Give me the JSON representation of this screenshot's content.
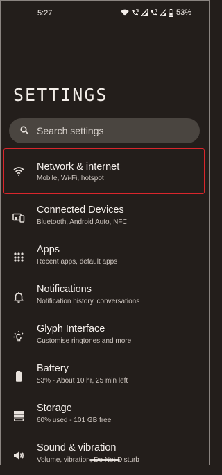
{
  "status": {
    "time": "5:27",
    "battery": "53%"
  },
  "page": {
    "title": "SETTINGS"
  },
  "search": {
    "placeholder": "Search settings"
  },
  "items": [
    {
      "label": "Network & internet",
      "sub": "Mobile, Wi-Fi, hotspot",
      "icon": "wifi-icon"
    },
    {
      "label": "Connected Devices",
      "sub": "Bluetooth, Android Auto, NFC",
      "icon": "devices-icon"
    },
    {
      "label": "Apps",
      "sub": "Recent apps, default apps",
      "icon": "apps-grid-icon"
    },
    {
      "label": "Notifications",
      "sub": "Notification history, conversations",
      "icon": "bell-icon"
    },
    {
      "label": "Glyph Interface",
      "sub": "Customise ringtones and more",
      "icon": "glyph-icon"
    },
    {
      "label": "Battery",
      "sub": "53% - About 10 hr, 25 min left",
      "icon": "battery-icon"
    },
    {
      "label": "Storage",
      "sub": "60% used - 101 GB free",
      "icon": "storage-icon"
    },
    {
      "label": "Sound & vibration",
      "sub": "Volume, vibration, Do Not Disturb",
      "icon": "speaker-icon"
    }
  ],
  "colors": {
    "background": "#231e1b",
    "search_bg": "#4a4540",
    "highlight_border": "#d9262c"
  }
}
